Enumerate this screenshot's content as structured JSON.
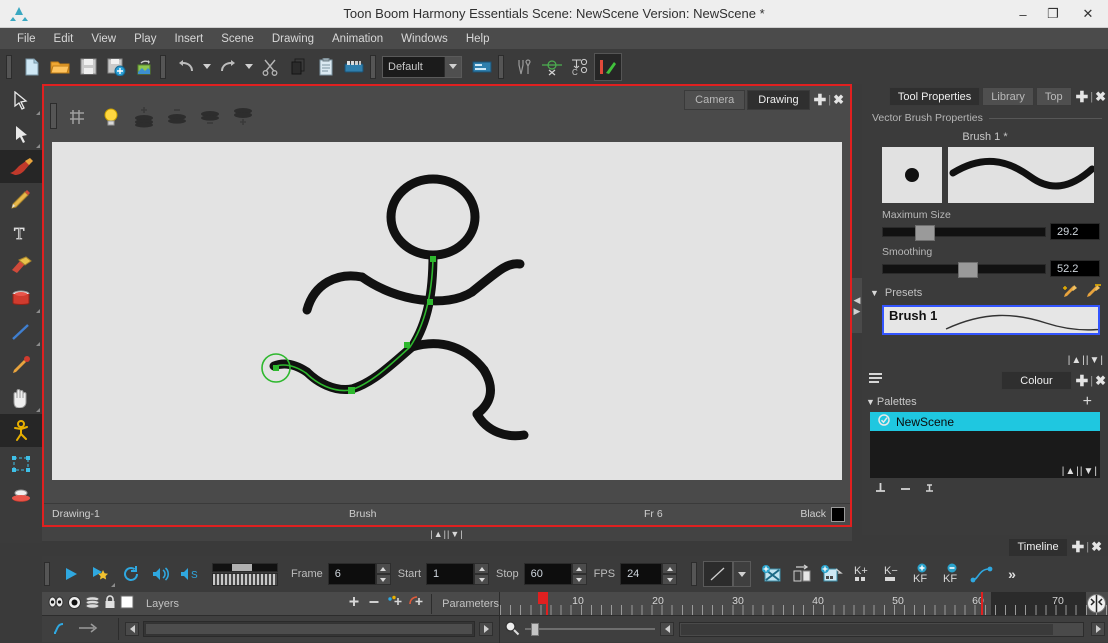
{
  "window": {
    "title": "Toon Boom Harmony Essentials Scene: NewScene Version: NewScene *",
    "minimize": "–",
    "maximize": "❐",
    "close": "✕"
  },
  "menubar": {
    "items": [
      "File",
      "Edit",
      "View",
      "Play",
      "Insert",
      "Scene",
      "Drawing",
      "Animation",
      "Windows",
      "Help"
    ]
  },
  "toolbar": {
    "icons": [
      "new-scene-icon",
      "open-scene-icon",
      "save-icon",
      "save-all-icon",
      "export-image-icon",
      "undo-icon",
      "undo-dropdown-icon",
      "redo-icon",
      "redo-dropdown-icon",
      "cut-icon",
      "copy-icon",
      "paste-icon",
      "colour-palette-icon"
    ],
    "workspace_value": "Default",
    "workspace_placeholder": "Default",
    "right_icons": [
      "tools-icon",
      "onion-skin-icon",
      "c-zoom-icon",
      "brush-flip-icon"
    ]
  },
  "left_tools": [
    {
      "name": "select-tool",
      "label": "Select"
    },
    {
      "name": "cutter-tool",
      "label": "Cutter"
    },
    {
      "name": "brush-tool",
      "label": "Brush"
    },
    {
      "name": "pencil-tool",
      "label": "Pencil"
    },
    {
      "name": "text-tool",
      "label": "Text"
    },
    {
      "name": "eraser-tool",
      "label": "Eraser"
    },
    {
      "name": "paint-tool",
      "label": "Paint"
    },
    {
      "name": "line-tool",
      "label": "Line"
    },
    {
      "name": "dropper-tool",
      "label": "Dropper"
    },
    {
      "name": "hand-tool",
      "label": "Hand"
    },
    {
      "name": "animate-tool",
      "label": "Animate"
    },
    {
      "name": "transform-tool",
      "label": "Transform"
    },
    {
      "name": "zoom-tool",
      "label": "Zoom"
    }
  ],
  "drawing_view": {
    "toolbar_icons": [
      "grid-icon",
      "light-table-icon",
      "add-layer-icon",
      "remove-layer-icon",
      "onion-layer-icon",
      "stack-add-icon"
    ],
    "tabs": [
      {
        "label": "Camera",
        "active": false
      },
      {
        "label": "Drawing",
        "active": true
      }
    ],
    "add_label": "✚",
    "close_label": "✖",
    "status": {
      "drawing": "Drawing-1",
      "tool": "Brush",
      "frame": "Fr 6",
      "colour": "Black"
    }
  },
  "tool_properties": {
    "tabs": [
      {
        "label": "Tool Properties",
        "active": true
      },
      {
        "label": "Library",
        "active": false
      },
      {
        "label": "Top",
        "active": false
      }
    ],
    "group_label": "Vector Brush Properties",
    "brush_name": "Brush 1 *",
    "maximum_size_label": "Maximum Size",
    "maximum_size_value": "29.2",
    "smoothing_label": "Smoothing",
    "smoothing_value": "52.2",
    "presets_label": "Presets",
    "preset_items": [
      "Brush 1"
    ],
    "new_preset_icon": "new-brush-preset-icon",
    "delete_preset_icon": "delete-brush-preset-icon"
  },
  "colour_panel": {
    "tabs": [
      {
        "label": "Colour",
        "active": true
      }
    ],
    "menu_icon": "panel-menu-icon",
    "palettes_label": "Palettes",
    "add_label": "+",
    "palettes": [
      {
        "name": "NewScene",
        "selected": true
      }
    ],
    "footer_icons": [
      "add-colour-icon",
      "remove-colour-icon",
      "text-colour-icon"
    ]
  },
  "playback": {
    "icons": [
      "play-icon",
      "loop-star-icon",
      "loop-icon",
      "sound-icon",
      "sound-scrub-icon"
    ],
    "frame_label": "Frame",
    "frame_value": "6",
    "start_label": "Start",
    "start_value": "1",
    "stop_label": "Stop",
    "stop_value": "60",
    "fps_label": "FPS",
    "fps_value": "24",
    "right_icons": [
      "line-style-icon",
      "line-style-dropdown-icon",
      "toggle-xsheet-icon",
      "flip-icon",
      "add-drawing-icon",
      "add-key-exposure-icon",
      "remove-key-exposure-icon",
      "add-keyframe-icon",
      "remove-keyframe-icon",
      "set-ease-icon"
    ],
    "overflow": "»"
  },
  "timeline": {
    "tab": {
      "label": "Timeline",
      "active": true
    },
    "add_label": "✚",
    "close_label": "✖",
    "header_icons": [
      "eye-icon",
      "onion-skin-icon",
      "layers-icon",
      "lock-icon",
      "colour-swatch-icon"
    ],
    "layers_label": "Layers",
    "parameters_label": "Parameters",
    "layer_buttons": [
      "add-layer-icon",
      "remove-layer-icon",
      "add-peg-icon",
      "add-parent-peg-icon"
    ],
    "ruler_labels": [
      "10",
      "20",
      "30",
      "40",
      "50",
      "60",
      "70"
    ],
    "playhead_frame": 6,
    "stop_marker_frame": 60,
    "zoom_icon": "magnify-icon"
  },
  "colors": {
    "accent_red": "#e02020",
    "panel_bg": "#3b3b3b",
    "canvas_bg": "#e3e3e3",
    "palette_sel": "#1fc7e0",
    "title_bg": "#eeeeee"
  },
  "canvas_art": {
    "description": "stick figure running drawing with green selected contour on leg",
    "stroke_color": "#111111",
    "selection_color": "#33bb33"
  }
}
